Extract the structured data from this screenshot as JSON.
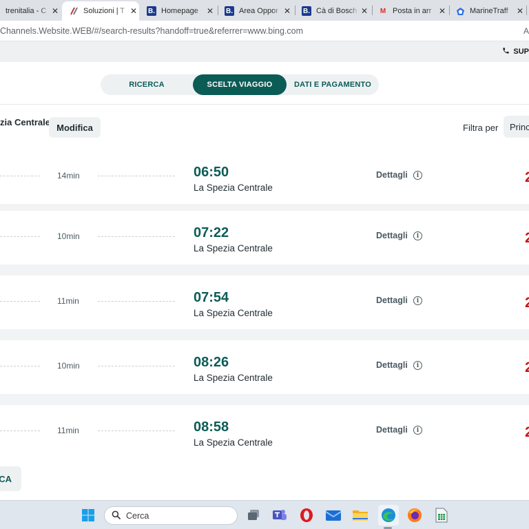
{
  "browser": {
    "tabs": [
      {
        "title": "trenitalia - C",
        "favicon": "none",
        "active": false
      },
      {
        "title": "Soluzioni | T",
        "favicon": "frecce-logo",
        "active": true
      },
      {
        "title": "Homepage",
        "favicon": "booking-b",
        "active": false
      },
      {
        "title": "Area Oppor",
        "favicon": "booking-b",
        "active": false
      },
      {
        "title": "Cà di Bosch",
        "favicon": "booking-b",
        "active": false
      },
      {
        "title": "Posta in arr",
        "favicon": "gmail-m",
        "active": false
      },
      {
        "title": "MarineTraff",
        "favicon": "marinetraffic-pentagon",
        "active": false
      }
    ],
    "close_glyph": "✕",
    "favicon_letters": {
      "booking": "B.",
      "gmail": "M"
    },
    "url": "Channels.Website.WEB/#/search-results?handoff=true&referrer=www.bing.com",
    "address_end": "A"
  },
  "site": {
    "support_label": "SUP",
    "stepper": {
      "steps": [
        "RICERCA",
        "SCELTA VIAGGIO",
        "DATI E PAGAMENTO"
      ],
      "active_index": 1
    },
    "route_title": "zia Centrale",
    "modify_button": "Modifica",
    "filter_label": "Filtra per",
    "sort_value": "Princ"
  },
  "results": [
    {
      "duration": "14min",
      "arrival_time": "06:50",
      "arrival_station": "La Spezia Centrale",
      "details": "Dettagli",
      "price_partial": "2"
    },
    {
      "duration": "10min",
      "arrival_time": "07:22",
      "arrival_station": "La Spezia Centrale",
      "details": "Dettagli",
      "price_partial": "2"
    },
    {
      "duration": "11min",
      "arrival_time": "07:54",
      "arrival_station": "La Spezia Centrale",
      "details": "Dettagli",
      "price_partial": "2"
    },
    {
      "duration": "10min",
      "arrival_time": "08:26",
      "arrival_station": "La Spezia Centrale",
      "details": "Dettagli",
      "price_partial": "2"
    },
    {
      "duration": "11min",
      "arrival_time": "08:58",
      "arrival_station": "La Spezia Centrale",
      "details": "Dettagli",
      "price_partial": "2"
    }
  ],
  "info_glyph": "i",
  "bottom_button": "CA",
  "taskbar": {
    "search_placeholder": "Cerca",
    "apps": [
      "start-icon",
      "search-box",
      "task-view-icon",
      "teams-icon",
      "opera-icon",
      "mail-icon",
      "file-explorer-icon",
      "edge-icon",
      "firefox-icon",
      "libreoffice-calc-icon"
    ]
  },
  "colors": {
    "brand_teal": "#0c5c56",
    "price_red": "#c41a1a",
    "page_bg": "#f1f3f4"
  }
}
